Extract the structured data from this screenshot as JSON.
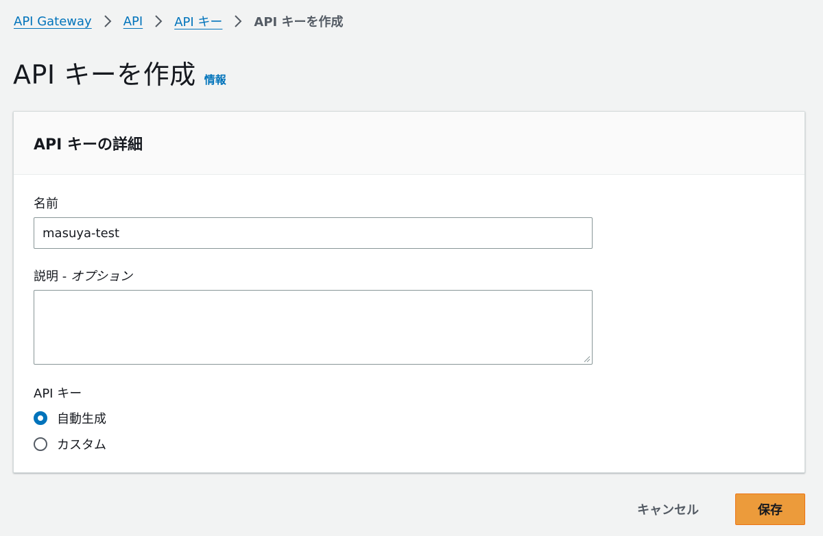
{
  "breadcrumb": {
    "items": [
      {
        "label": "API Gateway"
      },
      {
        "label": "API"
      },
      {
        "label": "API キー"
      }
    ],
    "current": "API キーを作成"
  },
  "header": {
    "title": "API キーを作成",
    "info_link": "情報"
  },
  "panel": {
    "title": "API キーの詳細",
    "name_field": {
      "label": "名前",
      "value": "masuya-test"
    },
    "description_field": {
      "label": "説明 - ",
      "optional": "オプション",
      "value": ""
    },
    "api_key": {
      "label": "API キー",
      "options": [
        {
          "label": "自動生成",
          "selected": true
        },
        {
          "label": "カスタム",
          "selected": false
        }
      ]
    }
  },
  "actions": {
    "cancel_label": "キャンセル",
    "save_label": "保存"
  },
  "colors": {
    "link": "#0073bb",
    "primary_button": "#ec9b3b",
    "background": "#f2f3f3"
  }
}
